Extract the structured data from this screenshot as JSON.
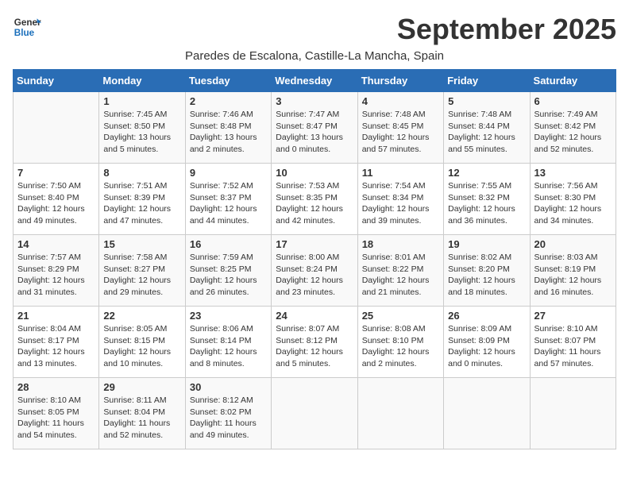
{
  "logo": {
    "line1": "General",
    "line2": "Blue"
  },
  "title": "September 2025",
  "subtitle": "Paredes de Escalona, Castille-La Mancha, Spain",
  "days_of_week": [
    "Sunday",
    "Monday",
    "Tuesday",
    "Wednesday",
    "Thursday",
    "Friday",
    "Saturday"
  ],
  "weeks": [
    [
      {
        "day": "",
        "info": ""
      },
      {
        "day": "1",
        "info": "Sunrise: 7:45 AM\nSunset: 8:50 PM\nDaylight: 13 hours\nand 5 minutes."
      },
      {
        "day": "2",
        "info": "Sunrise: 7:46 AM\nSunset: 8:48 PM\nDaylight: 13 hours\nand 2 minutes."
      },
      {
        "day": "3",
        "info": "Sunrise: 7:47 AM\nSunset: 8:47 PM\nDaylight: 13 hours\nand 0 minutes."
      },
      {
        "day": "4",
        "info": "Sunrise: 7:48 AM\nSunset: 8:45 PM\nDaylight: 12 hours\nand 57 minutes."
      },
      {
        "day": "5",
        "info": "Sunrise: 7:48 AM\nSunset: 8:44 PM\nDaylight: 12 hours\nand 55 minutes."
      },
      {
        "day": "6",
        "info": "Sunrise: 7:49 AM\nSunset: 8:42 PM\nDaylight: 12 hours\nand 52 minutes."
      }
    ],
    [
      {
        "day": "7",
        "info": "Sunrise: 7:50 AM\nSunset: 8:40 PM\nDaylight: 12 hours\nand 49 minutes."
      },
      {
        "day": "8",
        "info": "Sunrise: 7:51 AM\nSunset: 8:39 PM\nDaylight: 12 hours\nand 47 minutes."
      },
      {
        "day": "9",
        "info": "Sunrise: 7:52 AM\nSunset: 8:37 PM\nDaylight: 12 hours\nand 44 minutes."
      },
      {
        "day": "10",
        "info": "Sunrise: 7:53 AM\nSunset: 8:35 PM\nDaylight: 12 hours\nand 42 minutes."
      },
      {
        "day": "11",
        "info": "Sunrise: 7:54 AM\nSunset: 8:34 PM\nDaylight: 12 hours\nand 39 minutes."
      },
      {
        "day": "12",
        "info": "Sunrise: 7:55 AM\nSunset: 8:32 PM\nDaylight: 12 hours\nand 36 minutes."
      },
      {
        "day": "13",
        "info": "Sunrise: 7:56 AM\nSunset: 8:30 PM\nDaylight: 12 hours\nand 34 minutes."
      }
    ],
    [
      {
        "day": "14",
        "info": "Sunrise: 7:57 AM\nSunset: 8:29 PM\nDaylight: 12 hours\nand 31 minutes."
      },
      {
        "day": "15",
        "info": "Sunrise: 7:58 AM\nSunset: 8:27 PM\nDaylight: 12 hours\nand 29 minutes."
      },
      {
        "day": "16",
        "info": "Sunrise: 7:59 AM\nSunset: 8:25 PM\nDaylight: 12 hours\nand 26 minutes."
      },
      {
        "day": "17",
        "info": "Sunrise: 8:00 AM\nSunset: 8:24 PM\nDaylight: 12 hours\nand 23 minutes."
      },
      {
        "day": "18",
        "info": "Sunrise: 8:01 AM\nSunset: 8:22 PM\nDaylight: 12 hours\nand 21 minutes."
      },
      {
        "day": "19",
        "info": "Sunrise: 8:02 AM\nSunset: 8:20 PM\nDaylight: 12 hours\nand 18 minutes."
      },
      {
        "day": "20",
        "info": "Sunrise: 8:03 AM\nSunset: 8:19 PM\nDaylight: 12 hours\nand 16 minutes."
      }
    ],
    [
      {
        "day": "21",
        "info": "Sunrise: 8:04 AM\nSunset: 8:17 PM\nDaylight: 12 hours\nand 13 minutes."
      },
      {
        "day": "22",
        "info": "Sunrise: 8:05 AM\nSunset: 8:15 PM\nDaylight: 12 hours\nand 10 minutes."
      },
      {
        "day": "23",
        "info": "Sunrise: 8:06 AM\nSunset: 8:14 PM\nDaylight: 12 hours\nand 8 minutes."
      },
      {
        "day": "24",
        "info": "Sunrise: 8:07 AM\nSunset: 8:12 PM\nDaylight: 12 hours\nand 5 minutes."
      },
      {
        "day": "25",
        "info": "Sunrise: 8:08 AM\nSunset: 8:10 PM\nDaylight: 12 hours\nand 2 minutes."
      },
      {
        "day": "26",
        "info": "Sunrise: 8:09 AM\nSunset: 8:09 PM\nDaylight: 12 hours\nand 0 minutes."
      },
      {
        "day": "27",
        "info": "Sunrise: 8:10 AM\nSunset: 8:07 PM\nDaylight: 11 hours\nand 57 minutes."
      }
    ],
    [
      {
        "day": "28",
        "info": "Sunrise: 8:10 AM\nSunset: 8:05 PM\nDaylight: 11 hours\nand 54 minutes."
      },
      {
        "day": "29",
        "info": "Sunrise: 8:11 AM\nSunset: 8:04 PM\nDaylight: 11 hours\nand 52 minutes."
      },
      {
        "day": "30",
        "info": "Sunrise: 8:12 AM\nSunset: 8:02 PM\nDaylight: 11 hours\nand 49 minutes."
      },
      {
        "day": "",
        "info": ""
      },
      {
        "day": "",
        "info": ""
      },
      {
        "day": "",
        "info": ""
      },
      {
        "day": "",
        "info": ""
      }
    ]
  ]
}
